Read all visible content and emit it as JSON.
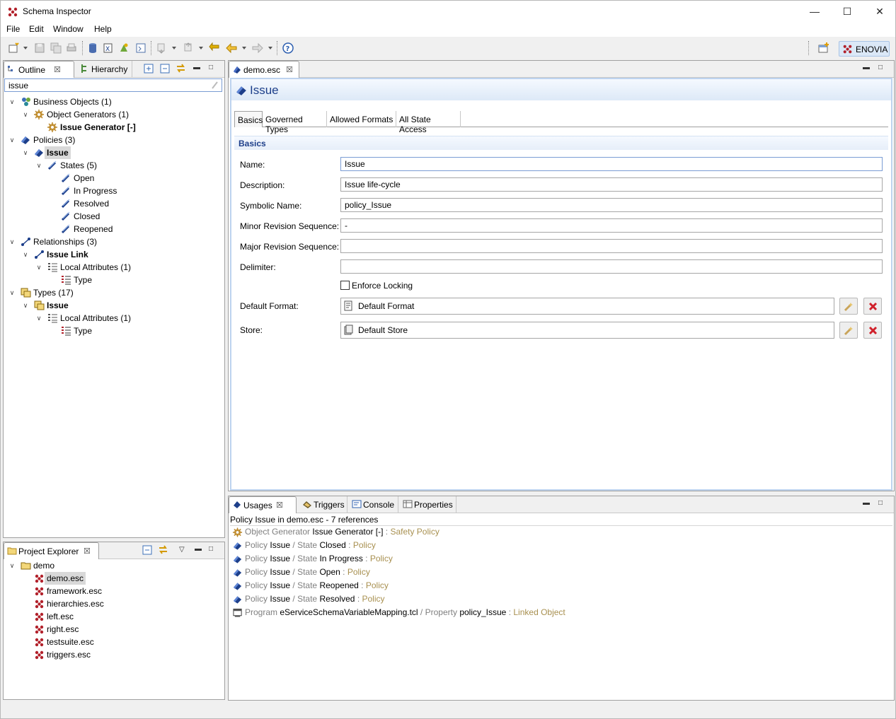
{
  "window": {
    "title": "Schema Inspector"
  },
  "menu": [
    "File",
    "Edit",
    "Window",
    "Help"
  ],
  "perspective": {
    "label": "ENOVIA"
  },
  "outline": {
    "tabs": [
      "Outline",
      "Hierarchy"
    ],
    "filter": "issue",
    "rows": [
      {
        "label": "Business Objects (1)",
        "bold": false
      },
      {
        "label": "Object Generators (1)",
        "bold": false
      },
      {
        "label": "Issue Generator [-]",
        "bold": true
      },
      {
        "label": "Policies (3)",
        "bold": false
      },
      {
        "label": "Issue",
        "bold": true
      },
      {
        "label": "States (5)",
        "bold": false
      },
      {
        "label": "Open",
        "bold": false
      },
      {
        "label": "In Progress",
        "bold": false
      },
      {
        "label": "Resolved",
        "bold": false
      },
      {
        "label": "Closed",
        "bold": false
      },
      {
        "label": "Reopened",
        "bold": false
      },
      {
        "label": "Relationships (3)",
        "bold": false
      },
      {
        "label": "Issue Link",
        "bold": true
      },
      {
        "label": "Local Attributes (1)",
        "bold": false
      },
      {
        "label": "Type",
        "bold": false
      },
      {
        "label": "Types (17)",
        "bold": false
      },
      {
        "label": "Issue",
        "bold": true
      },
      {
        "label": "Local Attributes (1)",
        "bold": false
      },
      {
        "label": "Type",
        "bold": false
      }
    ]
  },
  "project": {
    "tab": "Project Explorer",
    "root": "demo",
    "files": [
      "demo.esc",
      "framework.esc",
      "hierarchies.esc",
      "left.esc",
      "right.esc",
      "testsuite.esc",
      "triggers.esc"
    ]
  },
  "editor": {
    "tab": "demo.esc",
    "heading": "Issue",
    "subtabs": [
      "Basics",
      "Governed Types",
      "Allowed Formats",
      "All State Access"
    ],
    "section": "Basics",
    "fields": {
      "name_label": "Name:",
      "name": "Issue",
      "description_label": "Description:",
      "description": "Issue life-cycle",
      "symbolic_label": "Symbolic Name:",
      "symbolic": "policy_Issue",
      "minor_label": "Minor Revision Sequence:",
      "minor": "-",
      "major_label": "Major Revision Sequence:",
      "major": "",
      "delimiter_label": "Delimiter:",
      "delimiter": "",
      "locking_label": "Enforce Locking",
      "format_label": "Default Format:",
      "format": "Default Format",
      "store_label": "Store:",
      "store": "Default Store"
    }
  },
  "bottom": {
    "tabs": [
      "Usages",
      "Triggers",
      "Console",
      "Properties"
    ],
    "summary": "Policy Issue in demo.esc - 7 references",
    "usages": [
      {
        "icon": "gear-icon",
        "kind": "Object Generator",
        "name": "Issue Generator [-]",
        "sep": "",
        "kind2": "",
        "name2": "",
        "role": "Safety Policy"
      },
      {
        "icon": "policy-icon",
        "kind": "Policy",
        "name": "Issue",
        "sep": "/",
        "kind2": "State",
        "name2": "Closed",
        "role": "Policy"
      },
      {
        "icon": "policy-icon",
        "kind": "Policy",
        "name": "Issue",
        "sep": "/",
        "kind2": "State",
        "name2": "In Progress",
        "role": "Policy"
      },
      {
        "icon": "policy-icon",
        "kind": "Policy",
        "name": "Issue",
        "sep": "/",
        "kind2": "State",
        "name2": "Open",
        "role": "Policy"
      },
      {
        "icon": "policy-icon",
        "kind": "Policy",
        "name": "Issue",
        "sep": "/",
        "kind2": "State",
        "name2": "Reopened",
        "role": "Policy"
      },
      {
        "icon": "policy-icon",
        "kind": "Policy",
        "name": "Issue",
        "sep": "/",
        "kind2": "State",
        "name2": "Resolved",
        "role": "Policy"
      },
      {
        "icon": "program-icon",
        "kind": "Program",
        "name": "eServiceSchemaVariableMapping.tcl",
        "sep": "/",
        "kind2": "Property",
        "name2": "policy_Issue",
        "role": "Linked Object"
      }
    ]
  }
}
